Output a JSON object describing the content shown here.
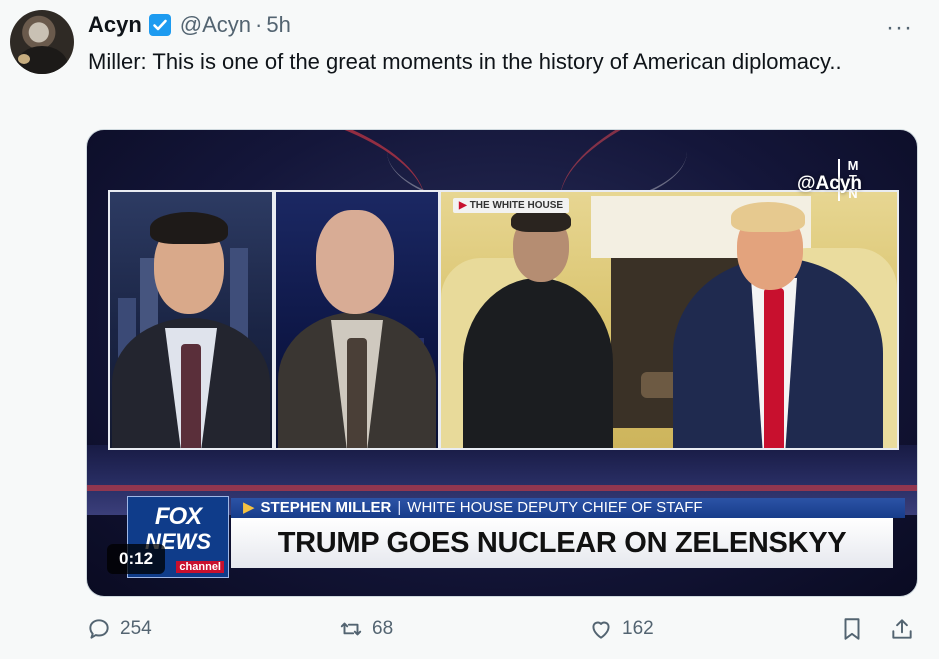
{
  "tweet": {
    "author_name": "Acyn",
    "handle": "@Acyn",
    "separator": "·",
    "time": "5h",
    "text": "Miller: This is one of the great moments in the history of American diplomacy..",
    "more_label": "···"
  },
  "video": {
    "watermark": "@Acyn",
    "watermark_logo": "MTN",
    "location_tag": "THE WHITE HOUSE",
    "network_logo": [
      "FOX",
      "NEWS",
      "channel"
    ],
    "strap_name": "STEPHEN MILLER",
    "strap_divider": "|",
    "strap_title": "WHITE HOUSE DEPUTY CHIEF OF STAFF",
    "headline": "TRUMP GOES NUCLEAR ON ZELENSKYY",
    "timestamp": "0:12"
  },
  "actions": {
    "replies": "254",
    "reposts": "68",
    "likes": "162"
  },
  "colors": {
    "verified": "#1d9bf0",
    "secondary_text": "#536471",
    "fox_blue": "#173c8a",
    "red_tie": "#c8102e"
  }
}
